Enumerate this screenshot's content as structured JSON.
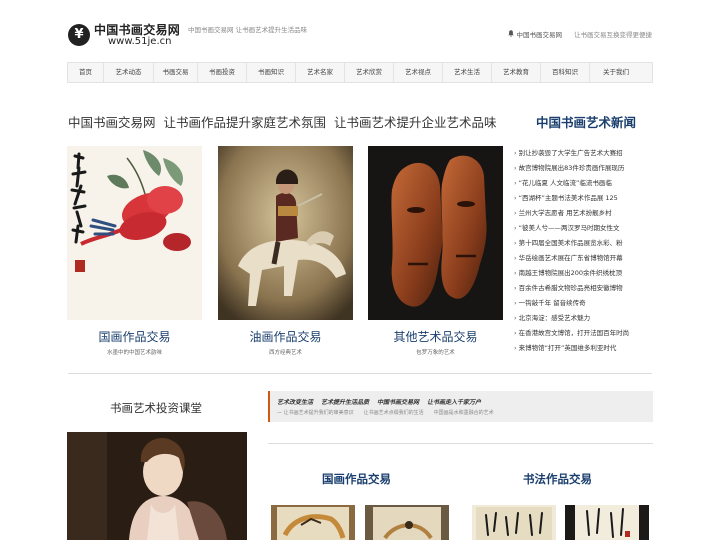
{
  "header": {
    "logo_mark": "¥",
    "logo_title": "中国书画交易网",
    "logo_url": "www.51je.cn",
    "slogan": "中国书画交易网   让书画艺术提升生活品味",
    "bell_icon": "bell-icon",
    "right_link": "中国书画交易网",
    "right_note": "让书画交易互换变得更便捷"
  },
  "nav": {
    "items": [
      "首页",
      "艺术动态",
      "书画交易",
      "书画投资",
      "书画知识",
      "艺术名家",
      "艺术欣赏",
      "艺术视点",
      "艺术生活",
      "艺术教育",
      "百科知识",
      "关于我们"
    ]
  },
  "headline": "中国书画交易网   让书画作品提升家庭艺术氛围   让书画艺术提升企业艺术品味",
  "gallery": [
    {
      "title": "国画作品交易",
      "subtitle": "水墨中的中国艺术韵味"
    },
    {
      "title": "油画作品交易",
      "subtitle": "西方经典艺术"
    },
    {
      "title": "其他艺术品交易",
      "subtitle": "包罗万象的艺术"
    }
  ],
  "news": {
    "heading": "中国书画艺术新闻",
    "bullet": "›",
    "items": [
      "别让抄袭毁了大学生广告艺术大赛招",
      "故宫博物院展出83件珍贵画作展现历",
      "“花儿临夏 人文临流”临流书画临",
      "“西湖杯”主题书法美术作品展 125",
      "兰州大学志愿者 用艺术扮靓乡村",
      "“彼美人兮——两汉罗马时期女性文",
      "第十四届全国美术作品展览水彩、粉",
      "华岳绘画艺术展在广东省博物馆开幕",
      "南越王博物院展出200余件织绣枕顶",
      "百余件古希腊文物珍品亮相安徽博物",
      "一钩敲千年 留音续传奇",
      "北京海淀：感受艺术魅力",
      "在香港故宫文博馆，打开法国百年时尚",
      "来博物馆“打开”英国维多利亚时代"
    ]
  },
  "course_title": "书画艺术投资课堂",
  "tags": {
    "main": [
      "艺术改变生活",
      "艺术提升生活品质",
      "中国书画交易网",
      "让书画走入千家万户"
    ],
    "sub": [
      "— 让书画艺术提升我们的审美意识",
      "让书画艺术点缀我们的生活",
      "中国画是水和墨融合的艺术"
    ]
  },
  "sections": {
    "guohua": "国画作品交易",
    "shufa": "书法作品交易"
  },
  "colors": {
    "accent_blue": "#1a3f6e",
    "tag_accent": "#d05a12"
  }
}
